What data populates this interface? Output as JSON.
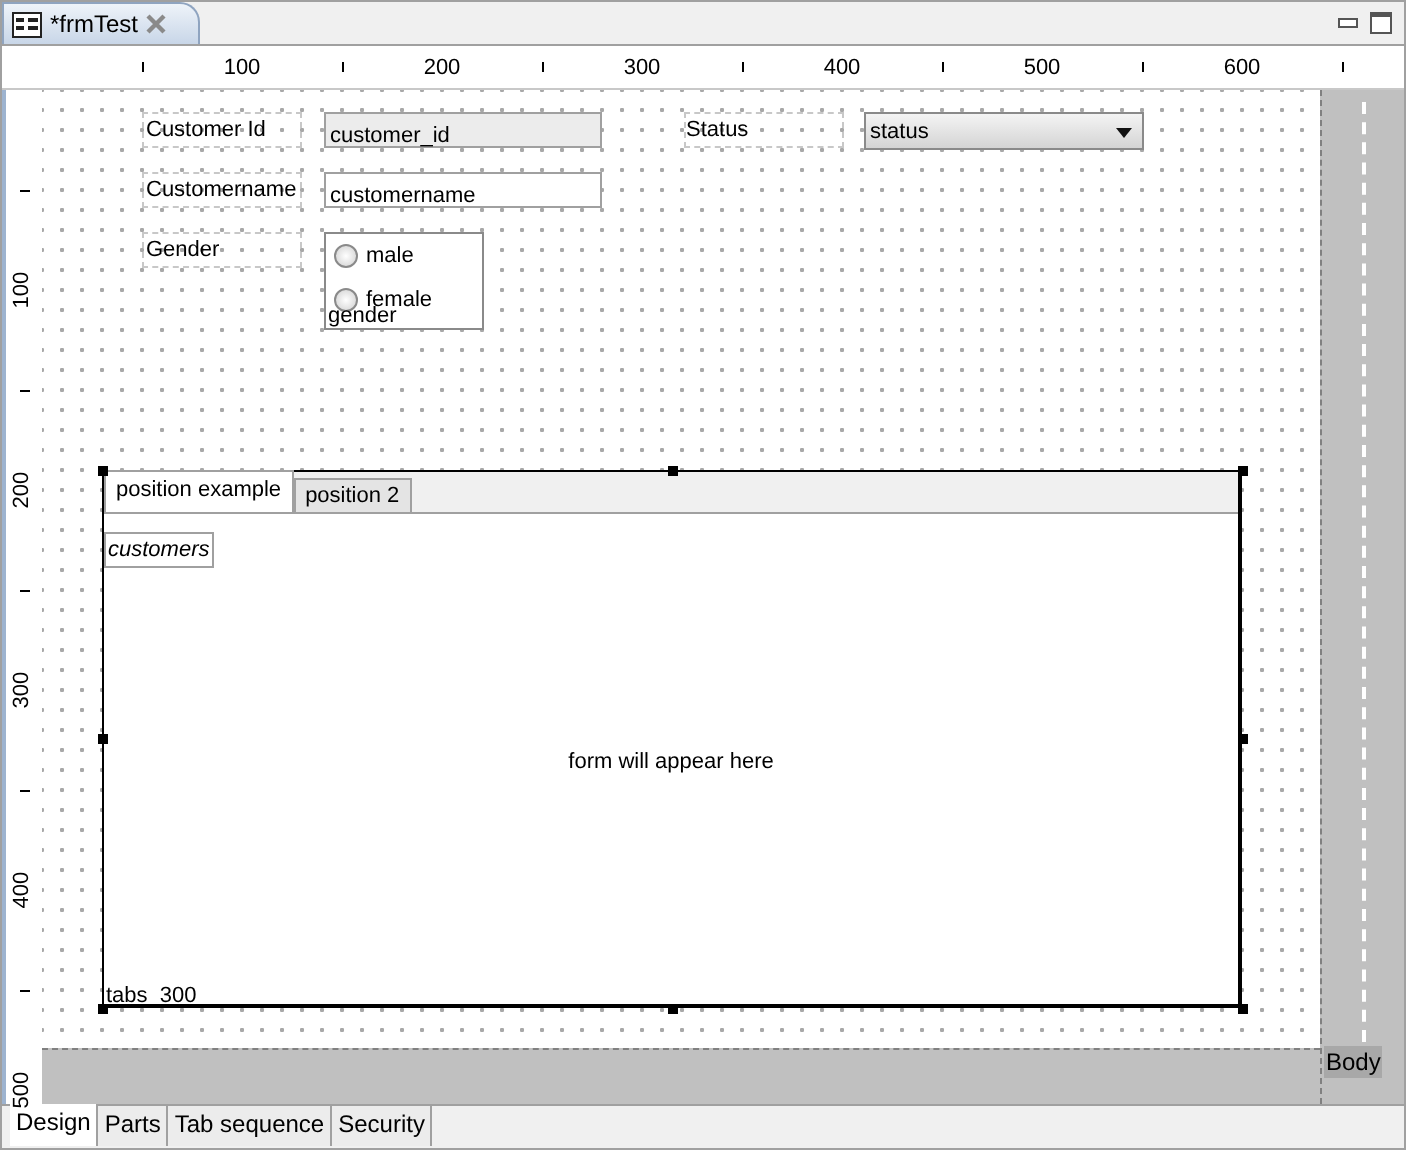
{
  "editor_tab": {
    "title": "*frmTest"
  },
  "ruler": {
    "horizontal": [
      "100",
      "200",
      "300",
      "400",
      "500",
      "600"
    ],
    "vertical": [
      "100",
      "200",
      "300",
      "400",
      "500"
    ]
  },
  "fields": [
    {
      "label": "Customer Id",
      "value": "customer_id",
      "readonly": true
    },
    {
      "label": "Customername",
      "value": "customername",
      "readonly": false
    }
  ],
  "status": {
    "label": "Status",
    "value": "status"
  },
  "gender": {
    "label": "Gender",
    "name": "gender",
    "options": [
      {
        "label": "male",
        "selected": false
      },
      {
        "label": "female",
        "selected": false
      }
    ]
  },
  "tab_panel": {
    "name": "tabs_300",
    "tabs": [
      {
        "label": "position example",
        "selected": true
      },
      {
        "label": "position 2",
        "selected": false
      }
    ],
    "form_label": "customers",
    "placeholder": "form will appear here"
  },
  "body_part": "Body",
  "bottom_tabs": [
    {
      "label": "Design",
      "selected": true
    },
    {
      "label": "Parts",
      "selected": false
    },
    {
      "label": "Tab sequence",
      "selected": false
    },
    {
      "label": "Security",
      "selected": false
    }
  ]
}
